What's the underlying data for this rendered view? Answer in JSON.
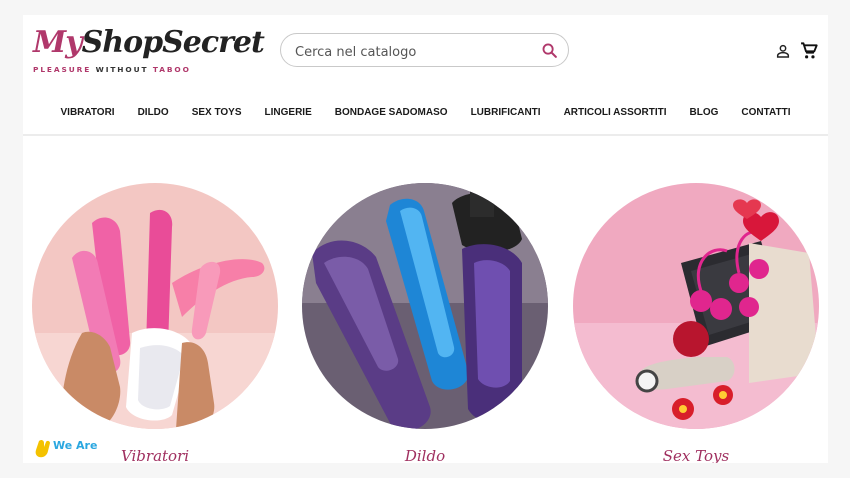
{
  "brand": {
    "name_part1": "My",
    "name_part2": "Shop",
    "name_part3": "Secret",
    "tagline_part1": "PLEASURE",
    "tagline_part2": "WITHOUT",
    "tagline_part3": "TABOO"
  },
  "search": {
    "placeholder": "Cerca nel catalogo"
  },
  "header_icons": [
    "user-icon",
    "cart-icon",
    "search-icon"
  ],
  "nav": {
    "items": [
      "VIBRATORI",
      "DILDO",
      "SEX TOYS",
      "LINGERIE",
      "BONDAGE SADOMASO",
      "LUBRIFICANTI",
      "ARTICOLI ASSORTITI",
      "BLOG",
      "CONTATTI"
    ]
  },
  "categories": [
    {
      "label": "Vibratori"
    },
    {
      "label": "Dildo"
    },
    {
      "label": "Sex Toys"
    }
  ],
  "badge": {
    "text": "We Are"
  },
  "colors": {
    "accent": "#b0386b",
    "label": "#a03060"
  }
}
